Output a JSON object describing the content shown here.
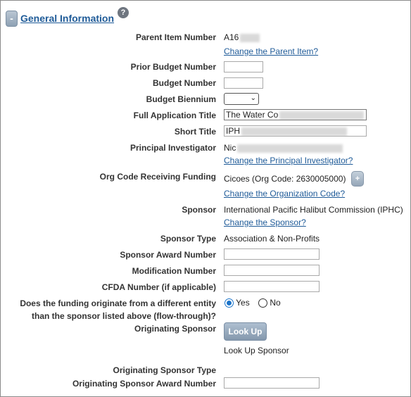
{
  "section": {
    "title": "General Information",
    "collapse_label": "-",
    "help_glyph": "?"
  },
  "fields": {
    "parent_item": {
      "label": "Parent Item Number",
      "value": "A16",
      "link": "Change the Parent Item?"
    },
    "prior_budget": {
      "label": "Prior Budget Number",
      "value": ""
    },
    "budget_number": {
      "label": "Budget Number",
      "value": ""
    },
    "budget_biennium": {
      "label": "Budget Biennium",
      "value": ""
    },
    "full_title": {
      "label": "Full Application Title",
      "value": "The Water Co"
    },
    "short_title": {
      "label": "Short Title",
      "value": "IPH"
    },
    "pi": {
      "label": "Principal Investigator",
      "value": "Nic",
      "link": "Change the Principal Investigator?"
    },
    "org_code": {
      "label": "Org Code Receiving Funding",
      "value": "Cicoes (Org Code: 2630005000)",
      "add_label": "+",
      "link": "Change the Organization Code?"
    },
    "sponsor": {
      "label": "Sponsor",
      "value": "International Pacific Halibut Commission (IPHC)",
      "link": "Change the Sponsor?"
    },
    "sponsor_type": {
      "label": "Sponsor Type",
      "value": "Association & Non-Profits"
    },
    "sponsor_award": {
      "label": "Sponsor Award Number",
      "value": ""
    },
    "modification": {
      "label": "Modification Number",
      "value": ""
    },
    "cfda": {
      "label": "CFDA Number (if applicable)",
      "value": ""
    },
    "flow_through": {
      "label_line1": "Does the funding originate from a different entity",
      "label_line2": "than the sponsor listed above (flow-through)?",
      "yes": "Yes",
      "no": "No",
      "selected": "Yes"
    },
    "orig_sponsor": {
      "label": "Originating Sponsor",
      "button": "Look Up",
      "value": "Look Up Sponsor"
    },
    "orig_sponsor_type": {
      "label": "Originating Sponsor Type",
      "value": ""
    },
    "orig_sponsor_award": {
      "label": "Originating Sponsor Award Number",
      "value": ""
    }
  }
}
